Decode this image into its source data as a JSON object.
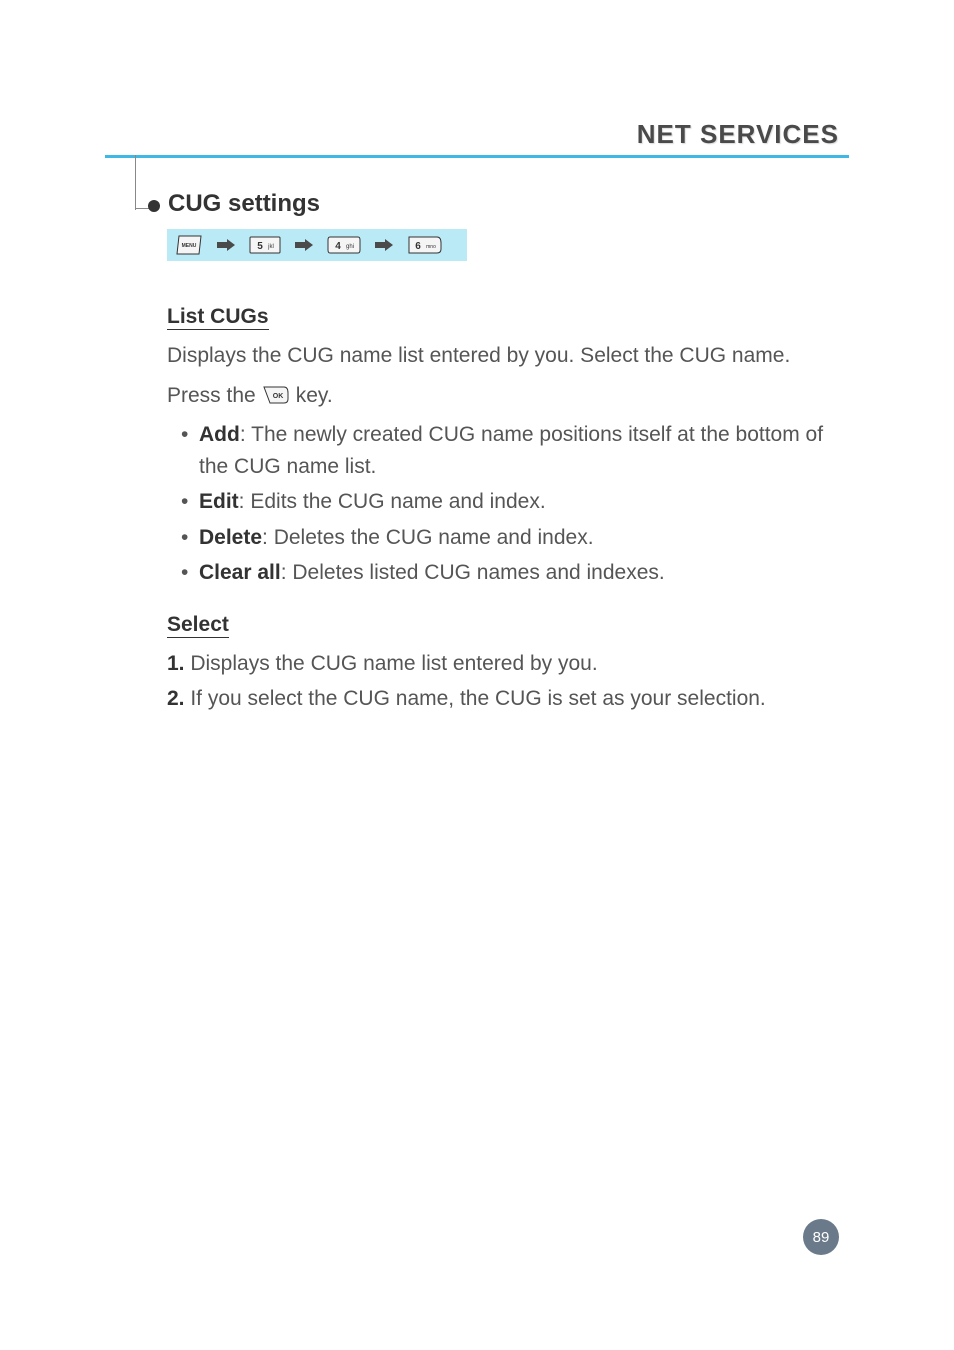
{
  "header": {
    "title": "NET SERVICES"
  },
  "section": {
    "title": "CUG settings"
  },
  "listCugs": {
    "heading": "List CUGs",
    "intro1": "Displays the CUG name list entered by you. Select the CUG name.",
    "intro2_pre": "Press the ",
    "intro2_post": " key.",
    "items": [
      {
        "label": "Add",
        "text": ": The newly created CUG name positions itself at the bottom of the CUG name list."
      },
      {
        "label": "Edit",
        "text": ": Edits the CUG name and index."
      },
      {
        "label": "Delete",
        "text": ": Deletes the CUG name and index."
      },
      {
        "label": "Clear all",
        "text": ": Deletes listed CUG names and indexes."
      }
    ]
  },
  "select": {
    "heading": "Select",
    "items": [
      {
        "num": "1.",
        "text": " Displays the CUG name list entered by you."
      },
      {
        "num": "2.",
        "text": " If you select the CUG name, the CUG is set as your selection."
      }
    ]
  },
  "pageNumber": "89",
  "keypad": {
    "menu": "MENU",
    "key5": "5 jkl",
    "key4": "4 ghi",
    "key6": "6 mno",
    "ok": "OK"
  }
}
